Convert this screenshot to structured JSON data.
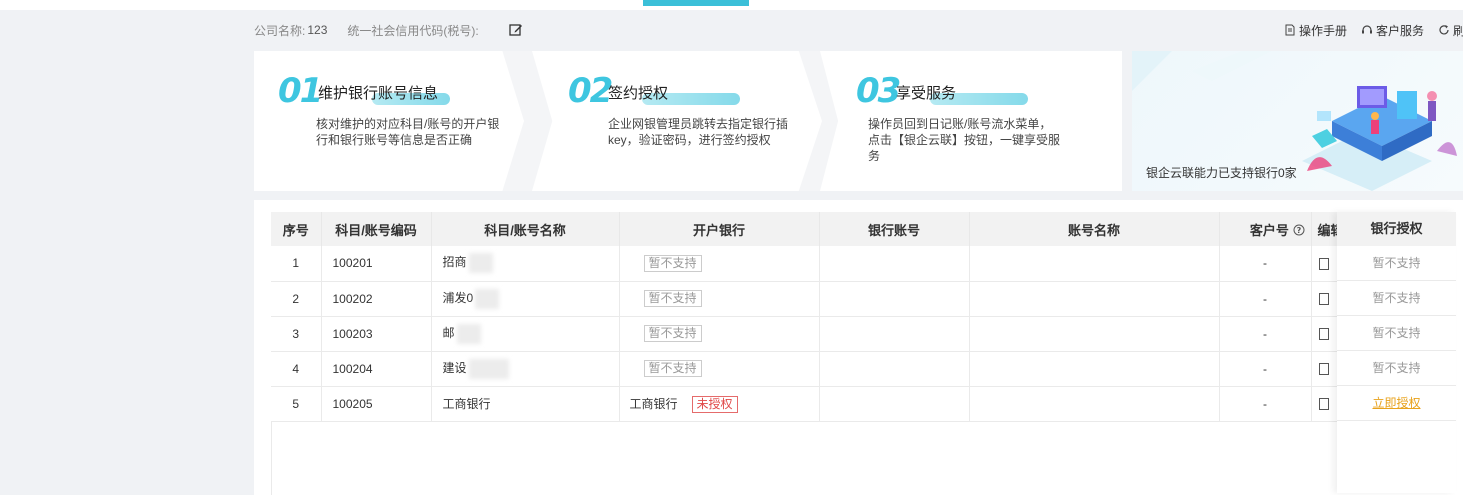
{
  "company": {
    "name_label": "公司名称:",
    "name_value": "123",
    "credit_label": "统一社会信用代码(税号):",
    "credit_value": ""
  },
  "toolbar": {
    "manual_label": "操作手册",
    "service_label": "客户服务",
    "refresh_label": "刷新"
  },
  "steps": [
    {
      "num": "01",
      "title": "维护银行账号信息",
      "desc_lines": [
        "核对维护的对应科目/账号的开户银",
        "行和银行账号等信息是否正确"
      ]
    },
    {
      "num": "02",
      "title": "签约授权",
      "desc_lines": [
        "企业网银管理员跳转去指定银行插",
        "key，验证密码，进行签约授权"
      ]
    },
    {
      "num": "03",
      "title": "享受服务",
      "desc_lines": [
        "操作员回到日记账/账号流水菜单，",
        "点击【银企云联】按钮，一键享受服",
        "务"
      ]
    }
  ],
  "banner": {
    "text": "银企云联能力已支持银行0家"
  },
  "table": {
    "headers": {
      "seq": "序号",
      "code": "科目/账号编码",
      "name": "科目/账号名称",
      "bank": "开户银行",
      "account": "银行账号",
      "account_name": "账号名称",
      "customer_no": "客户号",
      "edit": "编辑",
      "auth": "银行授权"
    },
    "rows": [
      {
        "seq": "1",
        "code": "100201",
        "name": "招商",
        "bank": "",
        "bank_tag": "暂不支持",
        "customer_no": "-",
        "auth": "暂不支持"
      },
      {
        "seq": "2",
        "code": "100202",
        "name": "浦发0",
        "bank": "",
        "bank_tag": "暂不支持",
        "customer_no": "-",
        "auth": "暂不支持"
      },
      {
        "seq": "3",
        "code": "100203",
        "name": "邮",
        "bank": "",
        "bank_tag": "暂不支持",
        "customer_no": "-",
        "auth": "暂不支持"
      },
      {
        "seq": "4",
        "code": "100204",
        "name": "建设",
        "bank": "",
        "bank_tag": "暂不支持",
        "customer_no": "-",
        "auth": "暂不支持"
      },
      {
        "seq": "5",
        "code": "100205",
        "name": "工商银行",
        "bank": "工商银行",
        "bank_tag": "未授权",
        "customer_no": "-",
        "auth": "立即授权"
      }
    ]
  },
  "colors": {
    "accent": "#3bbfd8",
    "link_orange": "#e8a21b",
    "danger_red": "#e04848"
  }
}
